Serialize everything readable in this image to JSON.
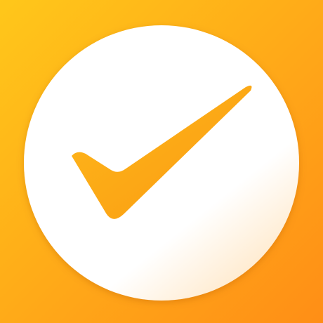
{
  "icon": {
    "name": "checkmark-app-icon",
    "glyph": "check-mark-icon"
  },
  "colors": {
    "background_start": "#FFC71A",
    "background_end": "#FF8E16",
    "circle": "#FFFFFF",
    "circle_shade": "#FFE7C6",
    "checkmark_start": "#FFB81A",
    "checkmark_end": "#F99A12"
  }
}
